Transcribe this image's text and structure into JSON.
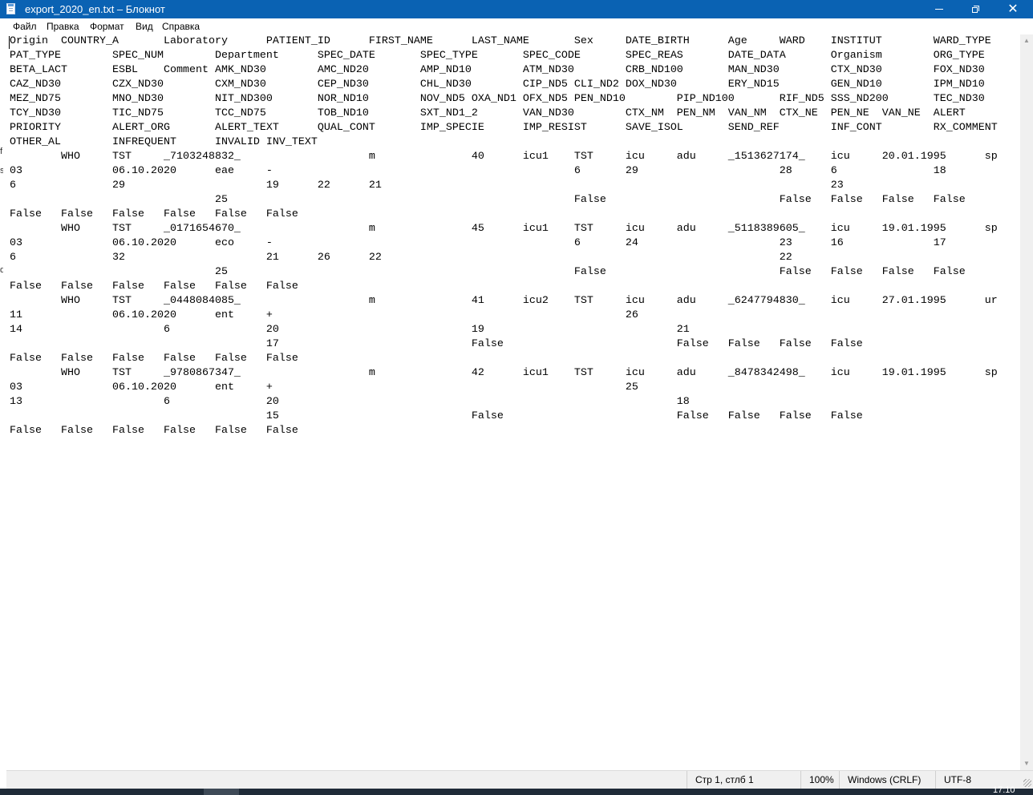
{
  "window": {
    "title": "export_2020_en.txt – Блокнот",
    "minimize_glyph": "",
    "maximize_glyph": "",
    "close_glyph": "✕"
  },
  "menu": [
    "Файл",
    "Правка",
    "Формат",
    "Вид",
    "Справка"
  ],
  "document": {
    "lines": [
      "Origin  COUNTRY_A       Laboratory      PATIENT_ID      FIRST_NAME      LAST_NAME       Sex     DATE_BIRTH      Age     WARD    INSTITUT        WARD_TYPE",
      "PAT_TYPE        SPEC_NUM        Department      SPEC_DATE       SPEC_TYPE       SPEC_CODE       SPEC_REAS       DATE_DATA       Organism        ORG_TYPE",
      "BETA_LACT       ESBL    Comment AMK_ND30        AMC_ND20        AMP_ND10        ATM_ND30        CRB_ND100       MAN_ND30        CTX_ND30        FOX_ND30",
      "CAZ_ND30        CZX_ND30        CXM_ND30        CEP_ND30        CHL_ND30        CIP_ND5 CLI_ND2 DOX_ND30        ERY_ND15        GEN_ND10        IPM_ND10",
      "MEZ_ND75        MNO_ND30        NIT_ND300       NOR_ND10        NOV_ND5 OXA_ND1 OFX_ND5 PEN_ND10        PIP_ND100       RIF_ND5 SSS_ND200       TEC_ND30",
      "TCY_ND30        TIC_ND75        TCC_ND75        TOB_ND10        SXT_ND1_2       VAN_ND30        CTX_NM  PEN_NM  VAN_NM  CTX_NE  PEN_NE  VAN_NE  ALERT",
      "PRIORITY        ALERT_ORG       ALERT_TEXT      QUAL_CONT       IMP_SPECIE      IMP_RESIST      SAVE_ISOL       SEND_REF        INF_CONT        RX_COMMENT",
      "OTHER_AL        INFREQUENT      INVALID INV_TEXT",
      "        WHO     TST     _7103248832_                    m               40      icu1    TST     icu     adu     _1513627174_    icu     20.01.1995      sp",
      "03              06.10.2020      eae     -                                               6       29                      28      6               18",
      "6               29                      19      22      21                                                                      23",
      "                                25                                                      False                           False   False   False   False",
      "False   False   False   False   False   False",
      "        WHO     TST     _0171654670_                    m               45      icu1    TST     icu     adu     _5118389605_    icu     19.01.1995      sp",
      "03              06.10.2020      eco     -                                               6       24                      23      16              17",
      "6               32                      21      26      22                                                              22",
      "                                25                                                      False                           False   False   False   False",
      "False   False   False   False   False   False",
      "        WHO     TST     _0448084085_                    m               41      icu2    TST     icu     adu     _6247794830_    icu     27.01.1995      ur",
      "11              06.10.2020      ent     +                                                       26",
      "14                      6               20                              19                              21",
      "                                        17                              False                           False   False   False   False",
      "False   False   False   False   False   False",
      "        WHO     TST     _9780867347_                    m               42      icu1    TST     icu     adu     _8478342498_    icu     19.01.1995      sp",
      "03              06.10.2020      ent     +                                                       25",
      "13                      6               20                                                              18",
      "                                        15                              False                           False   False   False   False",
      "False   False   False   False   False   False"
    ]
  },
  "left_fragments": [
    "f",
    "s",
    "d"
  ],
  "statusbar": {
    "position": "Стр 1, стлб 1",
    "zoom": "100%",
    "line_endings": "Windows (CRLF)",
    "encoding": "UTF-8"
  },
  "taskbar": {
    "clock": "17:10"
  },
  "colors": {
    "titlebar": "#0a62b3",
    "statusbar": "#f0f0f0",
    "taskbar": "#1f2b38"
  }
}
